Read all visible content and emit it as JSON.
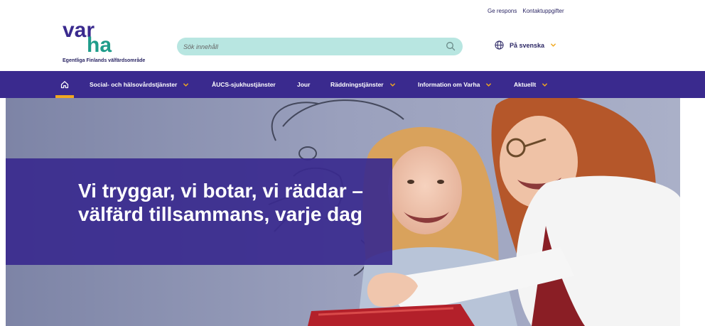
{
  "top_links": {
    "feedback": "Ge respons",
    "contact": "Kontaktuppgifter"
  },
  "logo": {
    "line1": "var",
    "line2": "ha",
    "tagline": "Egentliga Finlands välfärdsområde"
  },
  "search": {
    "placeholder": "Sök innehåll",
    "icon": "search-icon"
  },
  "language": {
    "label": "På svenska",
    "icon": "globe-icon"
  },
  "nav": {
    "home_icon": "home-icon",
    "items": [
      {
        "label": "Social- och hälsovårdstjänster",
        "has_dropdown": true
      },
      {
        "label": "ÅUCS-sjukhustjänster",
        "has_dropdown": false
      },
      {
        "label": "Jour",
        "has_dropdown": false
      },
      {
        "label": "Räddningstjänster",
        "has_dropdown": true
      },
      {
        "label": "Information om Varha",
        "has_dropdown": true
      },
      {
        "label": "Aktuellt",
        "has_dropdown": true
      }
    ]
  },
  "hero": {
    "title": "Vi tryggar, vi botar, vi räddar – välfärd tillsammans, varje dag"
  },
  "colors": {
    "brand_purple": "#3a2a8e",
    "brand_teal": "#1e9c8a",
    "accent_orange": "#f1a81f",
    "search_bg": "#b8e6e1"
  }
}
